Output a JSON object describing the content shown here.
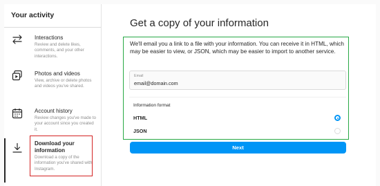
{
  "sidebar": {
    "title": "Your activity",
    "items": [
      {
        "label": "Interactions",
        "description": "Review and delete likes, comments, and your other interactions.",
        "icon": "interactions-arrows-icon"
      },
      {
        "label": "Photos and videos",
        "description": "View, archive or delete photos and videos you've shared.",
        "icon": "photos-videos-icon"
      },
      {
        "label": "Account history",
        "description": "Review changes you've made to your account since you created it.",
        "icon": "calendar-icon"
      },
      {
        "label": "Download your information",
        "description": "Download a copy of the information you've shared with Instagram.",
        "icon": "download-icon",
        "active": true
      }
    ]
  },
  "main": {
    "title": "Get a copy of your information",
    "intro": "We'll email you a link to a file with your information. You can receive it in HTML, which may be easier to view, or JSON, which may be easier to import to another service.",
    "email": {
      "label": "Email",
      "value": "email@domain.com"
    },
    "format": {
      "title": "Information format",
      "options": [
        {
          "label": "HTML",
          "selected": true
        },
        {
          "label": "JSON",
          "selected": false
        }
      ]
    },
    "next_label": "Next"
  },
  "colors": {
    "accent": "#0095f6",
    "highlight_red": "#d32222",
    "highlight_green": "#27a844"
  }
}
